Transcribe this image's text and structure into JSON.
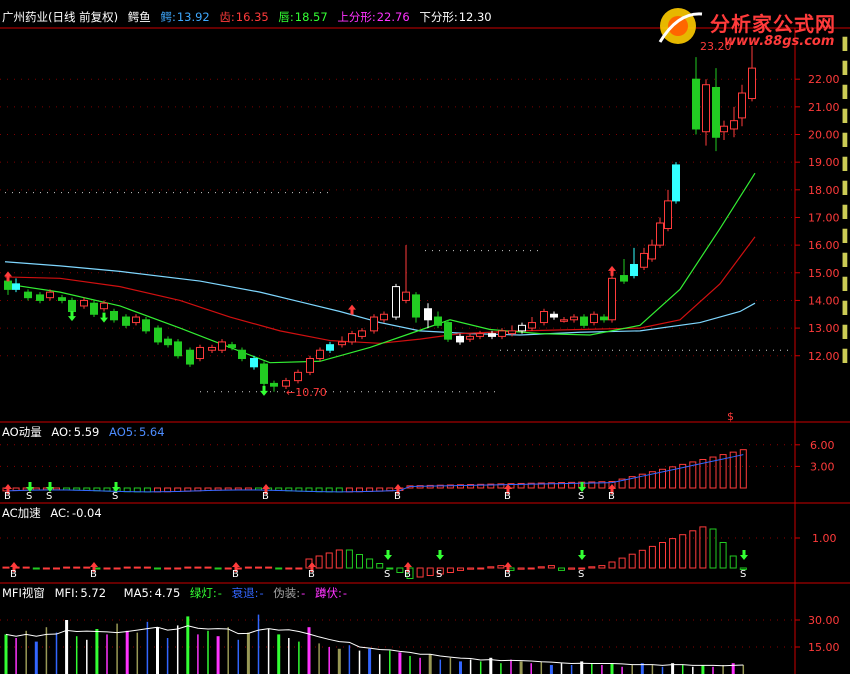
{
  "panels": {
    "main": {
      "stock_name": "广州药业(日线 前复权)",
      "indicator": "鳄鱼",
      "fields": [
        {
          "label": "鳄:",
          "value": "13.92",
          "color": "#3fa9ff"
        },
        {
          "label": "齿:",
          "value": "16.35",
          "color": "#ff3b3b"
        },
        {
          "label": "唇:",
          "value": "18.57",
          "color": "#33ff33"
        },
        {
          "label": "上分形:",
          "value": "22.76",
          "color": "#ff33ff"
        },
        {
          "label": "下分形:",
          "value": "12.30",
          "color": "#ffffff"
        }
      ],
      "price_labels": [
        "22.00",
        "21.00",
        "20.00",
        "19.00",
        "18.00",
        "17.00",
        "16.00",
        "15.00",
        "14.00",
        "13.00",
        "12.00"
      ],
      "high_label": "23.20",
      "low_label": "←10.70",
      "dollar_label": "$"
    },
    "ao": {
      "title": "AO动量",
      "ao_label": "AO:",
      "ao_value": "5.59",
      "ao5_label": "AO5:",
      "ao5_value": "5.64",
      "axis_labels": [
        "6.00",
        "3.00"
      ]
    },
    "ac": {
      "title": "AC加速",
      "ac_label": "AC:",
      "ac_value": "-0.04",
      "axis_labels": [
        "1.00"
      ]
    },
    "mfi": {
      "title": "MFI视窗",
      "mfi_label": "MFI:",
      "mfi_value": "5.72",
      "ma5_label": "MA5:",
      "ma5_value": "4.75",
      "green_light_label": "绿灯:",
      "green_light_value": "-",
      "fade_label": "衰退:",
      "fade_value": "-",
      "fake_label": "伪装:",
      "fake_value": "-",
      "squat_label": "蹲伏:",
      "squat_value": "-",
      "axis_labels": [
        "30.00",
        "15.00"
      ]
    }
  },
  "watermark": {
    "title": "分析家公式网",
    "url": "www.88gs.com"
  },
  "colors": {
    "up": "#ff3b3b",
    "down": "#22cc22",
    "squat": "#33ffff",
    "fake": "#ff33ff",
    "fade": "#3366ff",
    "green": "#33ff33",
    "axis": "#cc0000",
    "jaw": "#7fd7ff",
    "teeth": "#d01010",
    "lips": "#33ee33"
  }
}
